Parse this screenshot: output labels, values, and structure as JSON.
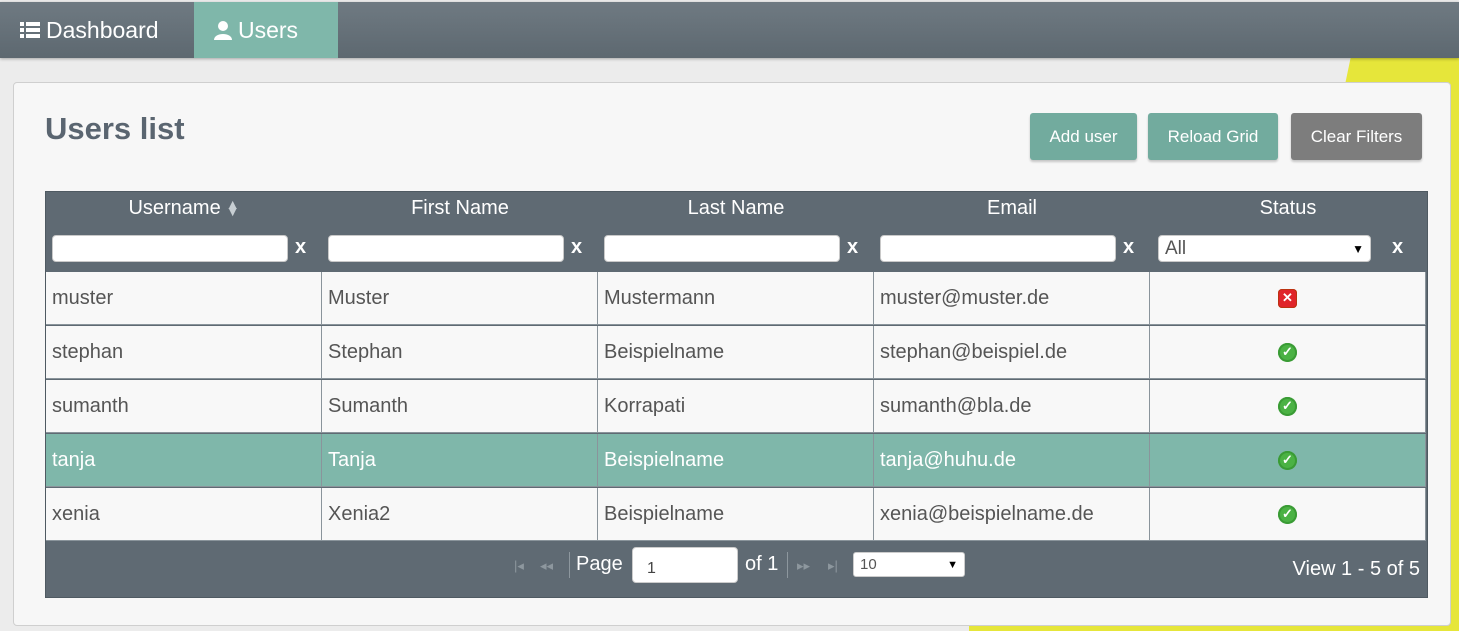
{
  "nav": {
    "dashboard_label": "Dashboard",
    "users_label": "Users",
    "dashboard_icon": "list-icon",
    "users_icon": "user-icon"
  },
  "page": {
    "title": "Users list",
    "buttons": {
      "add_user": "Add user",
      "reload_grid": "Reload Grid",
      "clear_filters": "Clear Filters"
    }
  },
  "grid": {
    "columns": [
      "Username",
      "First Name",
      "Last Name",
      "Email",
      "Status"
    ],
    "sorted_column": "Username",
    "filter_clear_label": "x",
    "status_filter_value": "All",
    "rows": [
      {
        "username": "muster",
        "first_name": "Muster",
        "last_name": "Mustermann",
        "email": "muster@muster.de",
        "status": "inactive"
      },
      {
        "username": "stephan",
        "first_name": "Stephan",
        "last_name": "Beispielname",
        "email": "stephan@beispiel.de",
        "status": "active"
      },
      {
        "username": "sumanth",
        "first_name": "Sumanth",
        "last_name": "Korrapati",
        "email": "sumanth@bla.de",
        "status": "active"
      },
      {
        "username": "tanja",
        "first_name": "Tanja",
        "last_name": "Beispielname",
        "email": "tanja@huhu.de",
        "status": "active",
        "selected": true
      },
      {
        "username": "xenia",
        "first_name": "Xenia2",
        "last_name": "Beispielname",
        "email": "xenia@beispielname.de",
        "status": "active"
      }
    ],
    "pager": {
      "page_label": "Page",
      "page_value": "1",
      "of_label": "of 1",
      "page_size": "10",
      "view_text": "View 1 - 5 of 5"
    }
  },
  "colors": {
    "accent": "#7fb7aa",
    "header": "#5f6a73",
    "inactive": "#e0242a",
    "active": "#4bb244"
  }
}
